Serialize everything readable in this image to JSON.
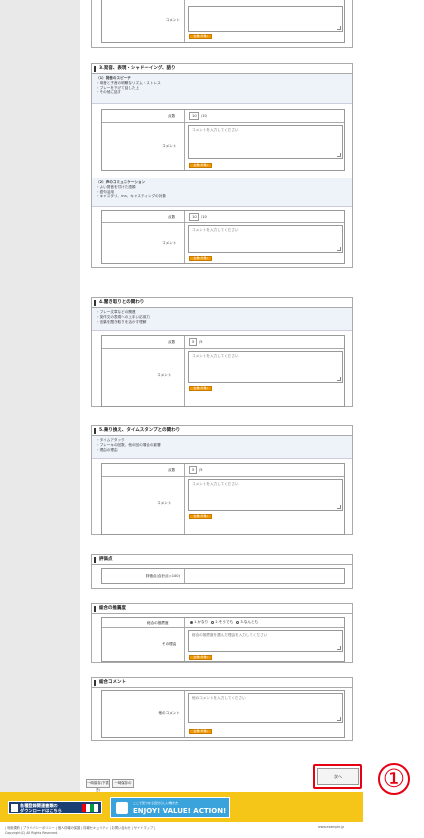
{
  "sections": {
    "top": {
      "comment_label": "コメント",
      "button_label": "全角(半角)"
    },
    "s3": {
      "title": "3.発音、表現・シャドーイング、語り",
      "sub1": {
        "title": "（1）発音のスピーチ",
        "bullets": [
          "・母音と子音の明瞭なリズム・ストレス",
          "・ブレーを下げて話した上",
          "・その他に話す"
        ],
        "score_label": "点数",
        "score_value": "10",
        "score_unit": "/10",
        "comment_label": "コメント",
        "placeholder": "コメントを入力してください",
        "button_label": "全角(半角)"
      },
      "sub2": {
        "title": "（2）声のコミュニケーション",
        "bullets": [
          "・よい発音を付けた語順",
          "・語句活用",
          "・キャスタリ、ma、キャスティングの対象"
        ],
        "score_label": "点数",
        "score_value": "10",
        "score_unit": "/10",
        "comment_label": "コメント",
        "placeholder": "コメントを入力してください",
        "button_label": "全角(半角)"
      }
    },
    "s4": {
      "title": "4.聞き取りとの関わり",
      "bullets": [
        "・ブレー文章などの関連",
        "・英作文の表現への上手い応用力",
        "・言葉を聞き取りを活かす理解"
      ],
      "score_label": "点数",
      "score_value": "5",
      "score_unit": "/5",
      "comment_label": "コメント",
      "placeholder": "コメントを入力してください",
      "button_label": "全角(半角)"
    },
    "s5": {
      "title": "5.乗り換え、タイムスタンプとの関わり",
      "bullets": [
        "・タイムアタック",
        "・ブレーキの回数、他の回の場合の影響",
        "・理由の理由"
      ],
      "score_label": "点数",
      "score_value": "5",
      "score_unit": "/5",
      "comment_label": "コメント",
      "placeholder": "コメントを入力してください",
      "button_label": "全角(半角)"
    },
    "eval": {
      "title": "評価点",
      "label": "評価点(合計点=100)"
    },
    "result": {
      "title": "総合の推薦度",
      "rec_label": "総合の推薦度",
      "options": [
        "1.かなり",
        "2.そうでも",
        "3.なんとも"
      ],
      "selected": 0,
      "reason_label": "その理由",
      "placeholder": "総合の推薦度を選んだ理由を入力してください",
      "button_label": "全角(半角)"
    },
    "comments": {
      "title": "総合コメント",
      "label": "他のコメント",
      "placeholder": "他のコメントを入力してください",
      "button_label": "全角(半角)"
    }
  },
  "actions": {
    "temp_save": "一時保存(下書き)",
    "temp_load": "一時保存の",
    "next": "次へ"
  },
  "banner": {
    "left_line1": "各種登録関連書類の",
    "left_line2": "ダウンロードはこちら",
    "right_main": "ENJOY! VALUE! ACTION!",
    "right_sub": "ここで見つかる自分らしい働き方"
  },
  "footer": {
    "links": "| 利用規約 | プライバシーポリシー | 個人情報の保護 | 情報セキュリティ | お問い合わせ | サイトマップ |",
    "copyright": "Copyright(C) All Rights Reserved.",
    "right": "www.example.jp"
  },
  "callout_number": "①"
}
